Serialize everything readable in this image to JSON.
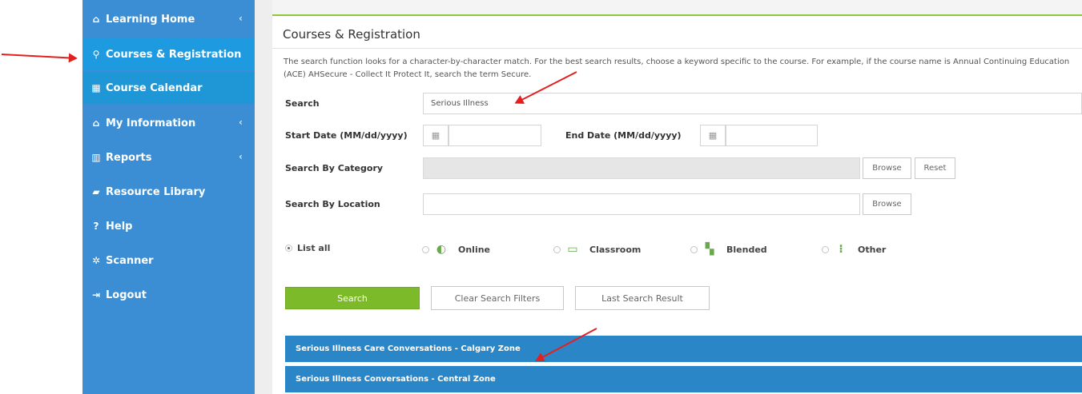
{
  "sidebar": {
    "items": [
      {
        "icon": "home-icon",
        "glyph": "⌂",
        "label": "Learning Home",
        "chevron": "‹"
      },
      {
        "icon": "search-icon",
        "glyph": "⚲",
        "label": "Courses & Registration"
      },
      {
        "icon": "calendar-icon",
        "glyph": "▦",
        "label": "Course Calendar"
      },
      {
        "icon": "graduation-cap-icon",
        "glyph": "⌂",
        "label": "My Information",
        "chevron": "‹"
      },
      {
        "icon": "bar-chart-icon",
        "glyph": "▥",
        "label": "Reports",
        "chevron": "‹"
      },
      {
        "icon": "book-icon",
        "glyph": "▰",
        "label": "Resource Library"
      },
      {
        "icon": "question-circle-icon",
        "glyph": "?",
        "label": "Help"
      },
      {
        "icon": "spinner-icon",
        "glyph": "✲",
        "label": "Scanner"
      },
      {
        "icon": "logout-icon",
        "glyph": "⇥",
        "label": "Logout"
      }
    ]
  },
  "main": {
    "title": "Courses & Registration",
    "description": "The search function looks for a character-by-character match. For the best search results, choose a keyword specific to the course. For example, if the course name is Annual Continuing Education (ACE) AHSecure - Collect It Protect It, search the term Secure.",
    "search_label": "Search",
    "search_value": "Serious Illness",
    "start_date_label": "Start Date (MM/dd/yyyy)",
    "end_date_label": "End Date (MM/dd/yyyy)",
    "start_date_value": "",
    "end_date_value": "",
    "category_label": "Search By Category",
    "location_label": "Search By Location",
    "browse_label": "Browse",
    "reset_label": "Reset",
    "radios": [
      {
        "label": "List all",
        "selected": true,
        "icon": ""
      },
      {
        "label": "Online",
        "selected": false,
        "icon": "online-course-icon"
      },
      {
        "label": "Classroom",
        "selected": false,
        "icon": "classroom-icon"
      },
      {
        "label": "Blended",
        "selected": false,
        "icon": "blended-icon"
      },
      {
        "label": "Other",
        "selected": false,
        "icon": "other-icon"
      }
    ],
    "search_button": "Search",
    "clear_button": "Clear Search Filters",
    "last_button": "Last Search Result",
    "results": [
      "Serious Illness Care Conversations - Calgary Zone",
      "Serious Illness Conversations - Central Zone"
    ]
  },
  "colors": {
    "sidebar": "#3b8ed3",
    "sidebar_active": "#1e9be0",
    "accent_green": "#7dba29",
    "result_bar": "#2a86c7",
    "annotation_arrow": "#e32020"
  }
}
